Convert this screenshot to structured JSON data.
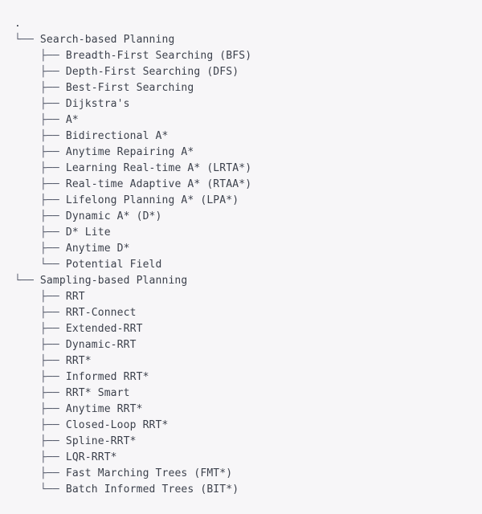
{
  "terminal": {
    "command_output_type": "tree",
    "root": ".",
    "colors": {
      "background": "#f7f6f8",
      "text": "#3c414c",
      "connector": "#5b6070"
    },
    "connectors": {
      "branch": "├── ",
      "last": "└── ",
      "vertical": "│   ",
      "space": "    "
    },
    "groups": [
      {
        "label": "Search-based Planning",
        "connector": "last",
        "children": [
          {
            "label": "Breadth-First Searching (BFS)",
            "connector": "branch"
          },
          {
            "label": "Depth-First Searching (DFS)",
            "connector": "branch"
          },
          {
            "label": "Best-First Searching",
            "connector": "branch"
          },
          {
            "label": "Dijkstra's",
            "connector": "branch"
          },
          {
            "label": "A*",
            "connector": "branch"
          },
          {
            "label": "Bidirectional A*",
            "connector": "branch"
          },
          {
            "label": "Anytime Repairing A*",
            "connector": "branch"
          },
          {
            "label": "Learning Real-time A* (LRTA*)",
            "connector": "branch"
          },
          {
            "label": "Real-time Adaptive A* (RTAA*)",
            "connector": "branch"
          },
          {
            "label": "Lifelong Planning A* (LPA*)",
            "connector": "branch"
          },
          {
            "label": "Dynamic A* (D*)",
            "connector": "branch"
          },
          {
            "label": "D* Lite",
            "connector": "branch"
          },
          {
            "label": "Anytime D*",
            "connector": "branch"
          },
          {
            "label": "Potential Field",
            "connector": "last"
          }
        ]
      },
      {
        "label": "Sampling-based Planning",
        "connector": "last",
        "children": [
          {
            "label": "RRT",
            "connector": "branch"
          },
          {
            "label": "RRT-Connect",
            "connector": "branch"
          },
          {
            "label": "Extended-RRT",
            "connector": "branch"
          },
          {
            "label": "Dynamic-RRT",
            "connector": "branch"
          },
          {
            "label": "RRT*",
            "connector": "branch"
          },
          {
            "label": "Informed RRT*",
            "connector": "branch"
          },
          {
            "label": "RRT* Smart",
            "connector": "branch"
          },
          {
            "label": "Anytime RRT*",
            "connector": "branch"
          },
          {
            "label": "Closed-Loop RRT*",
            "connector": "branch"
          },
          {
            "label": "Spline-RRT*",
            "connector": "branch"
          },
          {
            "label": "LQR-RRT*",
            "connector": "branch"
          },
          {
            "label": "Fast Marching Trees (FMT*)",
            "connector": "branch"
          },
          {
            "label": "Batch Informed Trees (BIT*)",
            "connector": "last"
          }
        ]
      }
    ]
  }
}
